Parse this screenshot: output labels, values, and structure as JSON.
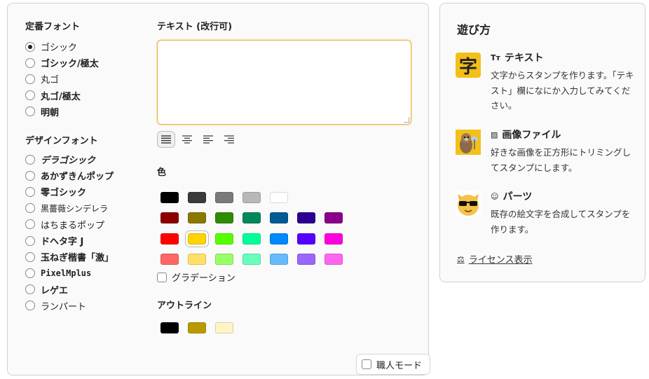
{
  "fonts": {
    "standard_title": "定番フォント",
    "standard": [
      {
        "label": "ゴシック",
        "checked": true
      },
      {
        "label": "ゴシック/極太",
        "checked": false
      },
      {
        "label": "丸ゴ",
        "checked": false
      },
      {
        "label": "丸ゴ/極太",
        "checked": false
      },
      {
        "label": "明朝",
        "checked": false
      }
    ],
    "design_title": "デザインフォント",
    "design": [
      {
        "label": "デラゴシック"
      },
      {
        "label": "あかずきんポップ"
      },
      {
        "label": "零ゴシック"
      },
      {
        "label": "黒薔薇シンデレラ"
      },
      {
        "label": "はちまるポップ"
      },
      {
        "label": "ドヘタ字 J"
      },
      {
        "label": "玉ねぎ楷書「激」"
      },
      {
        "label": "PixelMplus"
      },
      {
        "label": "レゲエ"
      },
      {
        "label": "ランパート"
      }
    ]
  },
  "text_section": {
    "title": "テキスト (改行可)",
    "value": "",
    "align_buttons": [
      "justify-icon",
      "align-center-icon",
      "align-left-icon",
      "align-right-icon"
    ],
    "active_align": 0
  },
  "color_section": {
    "title": "色",
    "rows": [
      [
        "#000000",
        "#3a3a3a",
        "#7a7a7a",
        "#b8b8b8",
        "#ffffff"
      ],
      [
        "#8b0000",
        "#8b7800",
        "#2f8b00",
        "#00875a",
        "#005a96",
        "#2a0090",
        "#8a008a"
      ],
      [
        "#ff0000",
        "#ffd400",
        "#55ff00",
        "#00ff99",
        "#0088ff",
        "#5500ff",
        "#ff00dd"
      ],
      [
        "#ff6666",
        "#ffe066",
        "#99ff66",
        "#66ffbb",
        "#66bbff",
        "#9966ff",
        "#ff66ee"
      ]
    ],
    "selected": {
      "row": 2,
      "col": 1
    },
    "gradient_label": "グラデーション"
  },
  "outline_section": {
    "title": "アウトライン",
    "colors": [
      "#000000",
      "#b89a00",
      "#fff4c6"
    ]
  },
  "expert_mode_label": "職人モード",
  "howto": {
    "title": "遊び方",
    "items": [
      {
        "icon": "text-size-icon",
        "mini": "Tт",
        "heading": "テキスト",
        "thumb_char": "字",
        "desc": "文字からスタンプを作ります。「テキスト」欄になにか入力してみてください。"
      },
      {
        "icon": "image-icon",
        "mini": "▨",
        "heading": "画像ファイル",
        "thumb_char": "",
        "desc": "好きな画像を正方形にトリミングしてスタンプにします。"
      },
      {
        "icon": "face-icon",
        "mini": "☺",
        "heading": "パーツ",
        "thumb_char": "",
        "desc": "既存の絵文字を合成してスタンプを作ります。"
      }
    ],
    "license_label": "ライセンス表示"
  }
}
